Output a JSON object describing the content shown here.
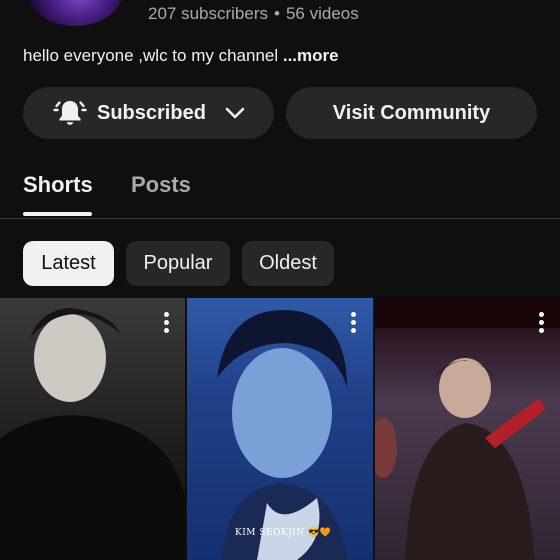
{
  "channel": {
    "subscribers": "207 subscribers",
    "separator": "•",
    "videos": "56 videos",
    "description": "hello everyone ,wlc to my channel ",
    "more": "...more"
  },
  "actions": {
    "subscribed_label": "Subscribed",
    "visit_label": "Visit Community"
  },
  "tabs": [
    {
      "label": "Shorts",
      "active": true
    },
    {
      "label": "Posts",
      "active": false
    }
  ],
  "filters": [
    {
      "label": "Latest",
      "selected": true
    },
    {
      "label": "Popular",
      "selected": false
    },
    {
      "label": "Oldest",
      "selected": false
    }
  ],
  "shorts": [
    {
      "menu_icon": "more-vert-icon"
    },
    {
      "menu_icon": "more-vert-icon",
      "overlay": "KIM SEOKJIN 😎🧡"
    },
    {
      "menu_icon": "more-vert-icon"
    }
  ],
  "colors": {
    "background": "#0f0f0f",
    "pill": "#272727",
    "text": "#f1f1f1",
    "muted": "#aaaaaa"
  }
}
